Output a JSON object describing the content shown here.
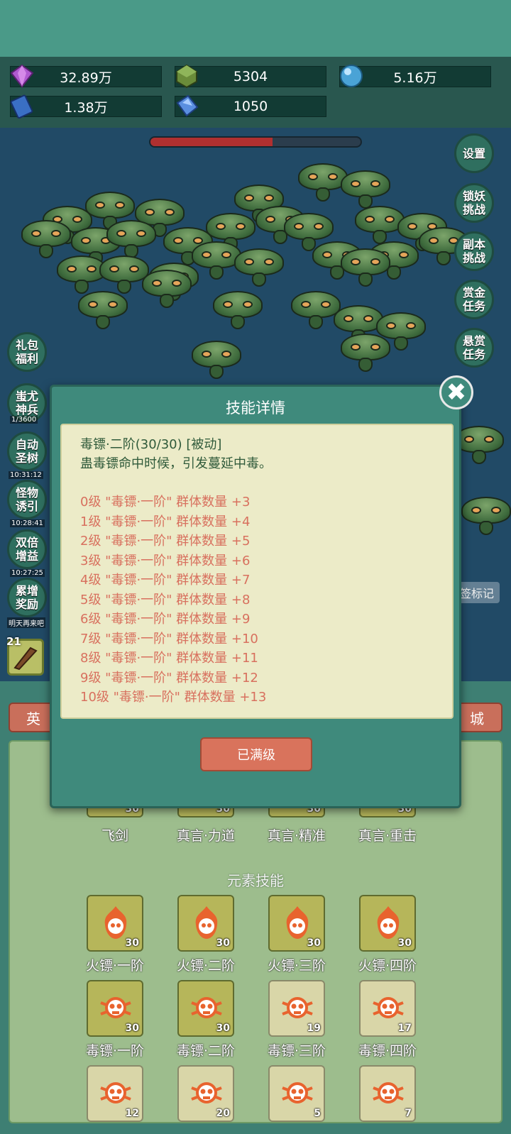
{
  "resources": [
    {
      "icon": "purple-gem-icon",
      "value": "32.89万"
    },
    {
      "icon": "green-crystal-icon",
      "value": "5304"
    },
    {
      "icon": "blue-orb-icon",
      "value": "5.16万"
    },
    {
      "icon": "blue-book-icon",
      "value": "1.38万"
    },
    {
      "icon": "blue-shard-icon",
      "value": "1050"
    }
  ],
  "boss_hp_fraction": 0.58,
  "right_buttons": [
    "设置",
    "锁妖挑战",
    "副本挑战",
    "赏金任务",
    "悬赏任务"
  ],
  "left_buttons": [
    {
      "label": "礼包福利",
      "time": ""
    },
    {
      "label": "蚩尤神兵",
      "time": "1/3600"
    },
    {
      "label": "自动圣树",
      "time": "10:31:12"
    },
    {
      "label": "怪物诱引",
      "time": "10:28:41"
    },
    {
      "label": "双倍增益",
      "time": "10:27:25"
    },
    {
      "label": "累增奖励",
      "time": "明天再来吧"
    }
  ],
  "mid_label": "签标记",
  "hero_level": "21",
  "tabs": [
    "英",
    "城"
  ],
  "skills_top_row": [
    {
      "name": "飞剑",
      "level": "30"
    },
    {
      "name": "真言·力道",
      "level": "30"
    },
    {
      "name": "真言·精准",
      "level": "30"
    },
    {
      "name": "真言·重击",
      "level": "30"
    }
  ],
  "element_section_title": "元素技能",
  "fire_skills": [
    {
      "name": "火镖·一阶",
      "level": "30"
    },
    {
      "name": "火镖·二阶",
      "level": "30"
    },
    {
      "name": "火镖·三阶",
      "level": "30"
    },
    {
      "name": "火镖·四阶",
      "level": "30"
    }
  ],
  "poison_skills": [
    {
      "name": "毒镖·一阶",
      "level": "30"
    },
    {
      "name": "毒镖·二阶",
      "level": "30"
    },
    {
      "name": "毒镖·三阶",
      "level": "19"
    },
    {
      "name": "毒镖·四阶",
      "level": "17"
    }
  ],
  "bottom_skills": [
    {
      "level": "12"
    },
    {
      "level": "20"
    },
    {
      "level": "5"
    },
    {
      "level": "7"
    }
  ],
  "modal": {
    "title": "技能详情",
    "close": "✖",
    "skill_line": "毒镖·二阶(30/30) [被动]",
    "description": "蛊毒镖命中时候，引发蔓延中毒。",
    "levels": [
      "0级 \"毒镖·一阶\" 群体数量 +3",
      "1级 \"毒镖·一阶\" 群体数量 +4",
      "2级 \"毒镖·一阶\" 群体数量 +5",
      "3级 \"毒镖·一阶\" 群体数量 +6",
      "4级 \"毒镖·一阶\" 群体数量 +7",
      "5级 \"毒镖·一阶\" 群体数量 +8",
      "6级 \"毒镖·一阶\" 群体数量 +9",
      "7级 \"毒镖·一阶\" 群体数量 +10",
      "8级 \"毒镖·一阶\" 群体数量 +11",
      "9级 \"毒镖·一阶\" 群体数量 +12",
      "10级 \"毒镖·一阶\" 群体数量 +13"
    ],
    "button": "已满级"
  }
}
